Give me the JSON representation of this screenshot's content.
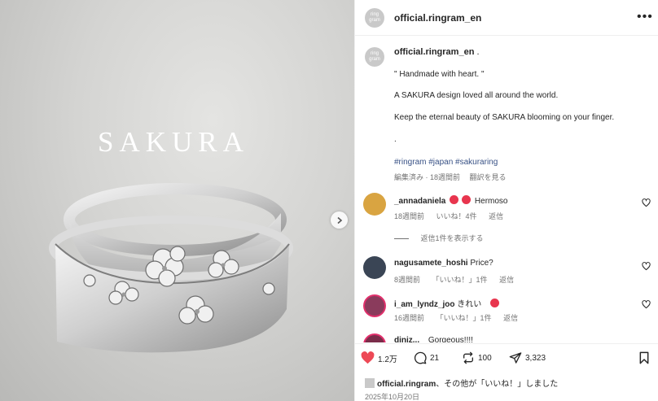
{
  "media": {
    "title": "SAKURA",
    "next_icon": "chevron-right-icon"
  },
  "header": {
    "avatar_text": "ring gram",
    "username": "official.ringram_en",
    "more_icon": "more-horizontal-icon"
  },
  "caption": {
    "avatar_text": "ring gram",
    "username": "official.ringram_en",
    "username_suffix": ".",
    "lines": [
      "\" Handmade with heart. \"",
      "A SAKURA design loved all around the world.",
      "Keep the eternal beauty of SAKURA blooming on your finger.",
      "."
    ],
    "hashtags": "#ringram #japan #sakuraring",
    "meta": "編集済み · 18週間前 　翻訳を見る"
  },
  "comments": [
    {
      "username": "_annadaniela",
      "text": "Hermoso",
      "time": "18週間前",
      "likes": "いいね！4件",
      "reply": "返信",
      "avatar_color": "#d9a441"
    },
    {
      "username": "nagusamete_hoshi",
      "text": "Price?",
      "time": "8週間前",
      "likes": "「いいね！」1件",
      "reply": "返信",
      "avatar_color": "#3a4555"
    },
    {
      "username": "i_am_lyndz_joo",
      "text": "きれい",
      "time": "16週間前",
      "likes": "「いいね！」1件",
      "reply": "返信",
      "avatar_color": "#8a3b5c"
    },
    {
      "username": "diniz...",
      "text": "Gorgeous!!!!",
      "time": "",
      "likes": "",
      "reply": "",
      "avatar_color": "#7a2d4a"
    }
  ],
  "view_replies": "返信1件を表示する",
  "actions": {
    "likes": "1.2万",
    "comments": "21",
    "reposts": "100",
    "shares": "3,323",
    "like_color": "#ed4956"
  },
  "liked_by": {
    "username": "official.ringram",
    "text": "、その他が「いいね！」しました"
  },
  "date": "2025年10月20日"
}
